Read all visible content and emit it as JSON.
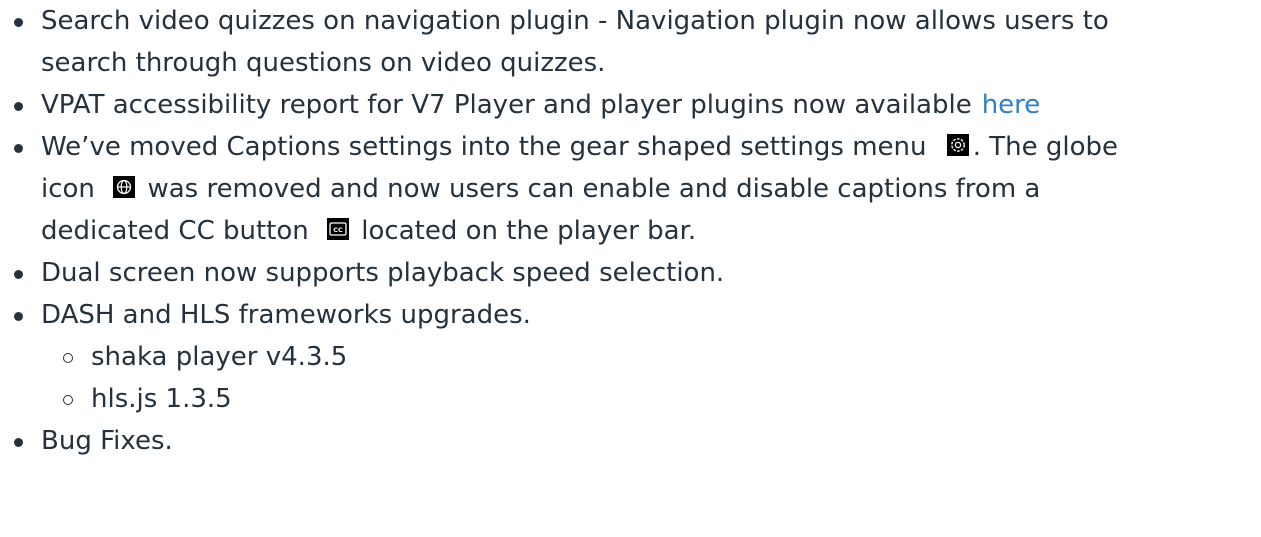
{
  "list": {
    "item1": {
      "line1": "Search video quizzes on navigation plugin - Navigation plugin now allows users to",
      "line2": "search through questions on video quizzes."
    },
    "item2": {
      "text": "VPAT accessibility report for V7 Player and player plugins now available",
      "link": "here"
    },
    "item3": {
      "part1": "We’ve moved Captions settings into the gear shaped settings menu",
      "part2": ". The globe",
      "part3": "icon",
      "part4": "was removed and now users can enable and disable captions from a",
      "part5": "dedicated CC button",
      "part6": "located on the player bar.",
      "icons": [
        "gear-icon",
        "globe-icon",
        "closed-captions-icon"
      ]
    },
    "item4": {
      "text": "Dual screen now supports playback speed selection."
    },
    "item5": {
      "text": "DASH and HLS frameworks upgrades.",
      "sub": [
        "shaka player v4.3.5",
        "hls.js 1.3.5"
      ]
    },
    "item6": {
      "text": "Bug Fixes."
    }
  },
  "colors": {
    "text": "#25313d",
    "link": "#2f80c8"
  }
}
